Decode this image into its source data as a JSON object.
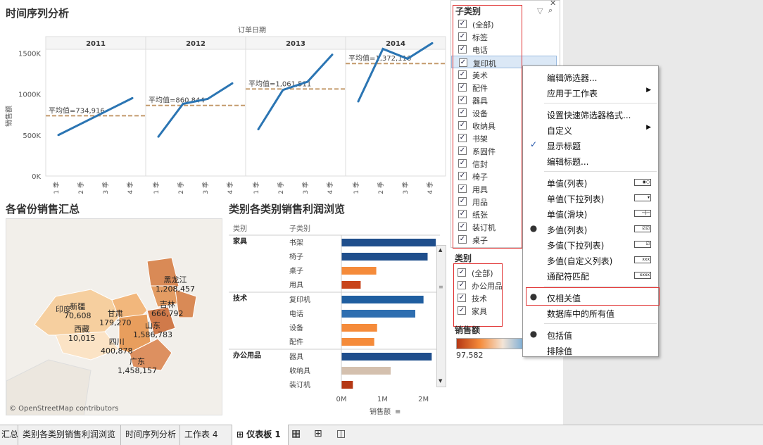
{
  "line_panel": {
    "title": "时间序列分析",
    "column_header": "订单日期",
    "y_axis_label": "销售额",
    "y_ticks": [
      "1500K",
      "1000K",
      "500K",
      "0K"
    ],
    "quarter_labels": [
      "1 季",
      "2 季",
      "3 季",
      "4 季"
    ]
  },
  "chart_data": [
    {
      "type": "line",
      "title": "时间序列分析",
      "xlabel": "订单日期",
      "ylabel": "销售额",
      "ylim": [
        0,
        1700000
      ],
      "categories": [
        "1 季",
        "2 季",
        "3 季",
        "4 季"
      ],
      "series": [
        {
          "name": "2011",
          "values": [
            500000,
            650000,
            800000,
            950000
          ],
          "average_label": "平均值=734,916",
          "average": 734916
        },
        {
          "name": "2012",
          "values": [
            480000,
            880000,
            940000,
            1130000
          ],
          "average_label": "平均值=860,844",
          "average": 860844
        },
        {
          "name": "2013",
          "values": [
            570000,
            1050000,
            1150000,
            1480000
          ],
          "average_label": "平均值=1,061,511",
          "average": 1061511
        },
        {
          "name": "2014",
          "values": [
            910000,
            1550000,
            1430000,
            1620000
          ],
          "average_label": "平均值=1,372,116",
          "average": 1372116
        }
      ]
    },
    {
      "type": "bar",
      "title": "类别各类别销售利润浏览",
      "xlabel": "销售额",
      "xlim": [
        0,
        2400000
      ],
      "x_ticks": [
        "0M",
        "1M",
        "2M"
      ],
      "col_headers": [
        "类别",
        "子类别"
      ],
      "groups": [
        {
          "name": "家具",
          "rows": [
            {
              "label": "书架",
              "value": 2300000,
              "color": "#1f4e8c"
            },
            {
              "label": "椅子",
              "value": 2100000,
              "color": "#1f4e8c"
            },
            {
              "label": "桌子",
              "value": 850000,
              "color": "#f58b3a"
            },
            {
              "label": "用具",
              "value": 470000,
              "color": "#c8441b"
            }
          ]
        },
        {
          "name": "技术",
          "rows": [
            {
              "label": "复印机",
              "value": 2000000,
              "color": "#1f5ea0"
            },
            {
              "label": "电话",
              "value": 1800000,
              "color": "#2e6eb0"
            },
            {
              "label": "设备",
              "value": 870000,
              "color": "#f58b3a"
            },
            {
              "label": "配件",
              "value": 800000,
              "color": "#f58b3a"
            }
          ]
        },
        {
          "name": "办公用品",
          "rows": [
            {
              "label": "器具",
              "value": 2200000,
              "color": "#1f4e8c"
            },
            {
              "label": "收纳具",
              "value": 1200000,
              "color": "#d4c0ae"
            },
            {
              "label": "装订机",
              "value": 280000,
              "color": "#b53815"
            }
          ]
        }
      ]
    }
  ],
  "map_panel": {
    "title": "各省份销售汇总",
    "india_label": "印度",
    "attribution": "© OpenStreetMap contributors",
    "labels": [
      {
        "name": "新疆",
        "value": "70,608"
      },
      {
        "name": "西藏",
        "value": "10,015"
      },
      {
        "name": "甘肃",
        "value": "179,270"
      },
      {
        "name": "四川",
        "value": "400,878"
      },
      {
        "name": "黑龙江",
        "value": "1,208,457"
      },
      {
        "name": "吉林",
        "value": "666,792"
      },
      {
        "name": "山东",
        "value": "1,586,783"
      },
      {
        "name": "广东",
        "value": "1,458,157"
      }
    ]
  },
  "filter_subcat": {
    "title": "子类别",
    "items": [
      "(全部)",
      "标签",
      "电话",
      "复印机",
      "美术",
      "配件",
      "器具",
      "设备",
      "收纳具",
      "书架",
      "系固件",
      "信封",
      "椅子",
      "用具",
      "用品",
      "纸张",
      "装订机",
      "桌子"
    ]
  },
  "filter_cat": {
    "title": "类别",
    "items": [
      "(全部)",
      "办公用品",
      "技术",
      "家具"
    ]
  },
  "legend": {
    "title": "销售额",
    "min": "97,582",
    "colors": {
      "low": "#b53815",
      "mid": "#f3e4d6",
      "high": "#6fa8d6"
    }
  },
  "context_menu": {
    "items": [
      {
        "label": "编辑筛选器...",
        "mark": "",
        "arrow": false,
        "icon": ""
      },
      {
        "label": "应用于工作表",
        "mark": "",
        "arrow": true,
        "icon": ""
      },
      {
        "sep": true
      },
      {
        "label": "设置快速筛选器格式...",
        "mark": "",
        "arrow": false,
        "icon": ""
      },
      {
        "label": "自定义",
        "mark": "",
        "arrow": true,
        "icon": ""
      },
      {
        "label": "显示标题",
        "mark": "✓",
        "arrow": false,
        "icon": ""
      },
      {
        "label": "编辑标题...",
        "mark": "",
        "arrow": false,
        "icon": ""
      },
      {
        "sep": true
      },
      {
        "label": "单值(列表)",
        "mark": "",
        "arrow": false,
        "icon": "◉○"
      },
      {
        "label": "单值(下拉列表)",
        "mark": "",
        "arrow": false,
        "icon": "▾"
      },
      {
        "label": "单值(滑块)",
        "mark": "",
        "arrow": false,
        "icon": "─┼─"
      },
      {
        "label": "多值(列表)",
        "mark": "●",
        "arrow": false,
        "icon": "☑☑"
      },
      {
        "label": "多值(下拉列表)",
        "mark": "",
        "arrow": false,
        "icon": "☑"
      },
      {
        "label": "多值(自定义列表)",
        "mark": "",
        "arrow": false,
        "icon": "xxx"
      },
      {
        "label": "通配符匹配",
        "mark": "",
        "arrow": false,
        "icon": "xxxx"
      },
      {
        "sep": true
      },
      {
        "label": "仅相关值",
        "mark": "●",
        "arrow": false,
        "icon": ""
      },
      {
        "label": "数据库中的所有值",
        "mark": "",
        "arrow": false,
        "icon": ""
      },
      {
        "sep": true
      },
      {
        "label": "包括值",
        "mark": "●",
        "arrow": false,
        "icon": ""
      },
      {
        "label": "排除值",
        "mark": "",
        "arrow": false,
        "icon": ""
      }
    ]
  },
  "tabs": [
    {
      "label": "汇总",
      "active": false
    },
    {
      "label": "类别各类别销售利润浏览",
      "active": false
    },
    {
      "label": "时间序列分析",
      "active": false
    },
    {
      "label": "工作表 4",
      "active": false
    },
    {
      "label": "仪表板 1",
      "active": true
    }
  ],
  "colors": {
    "line": "#2b75b3",
    "avg": "#c49a6c",
    "highlight_box": "#e03030"
  }
}
